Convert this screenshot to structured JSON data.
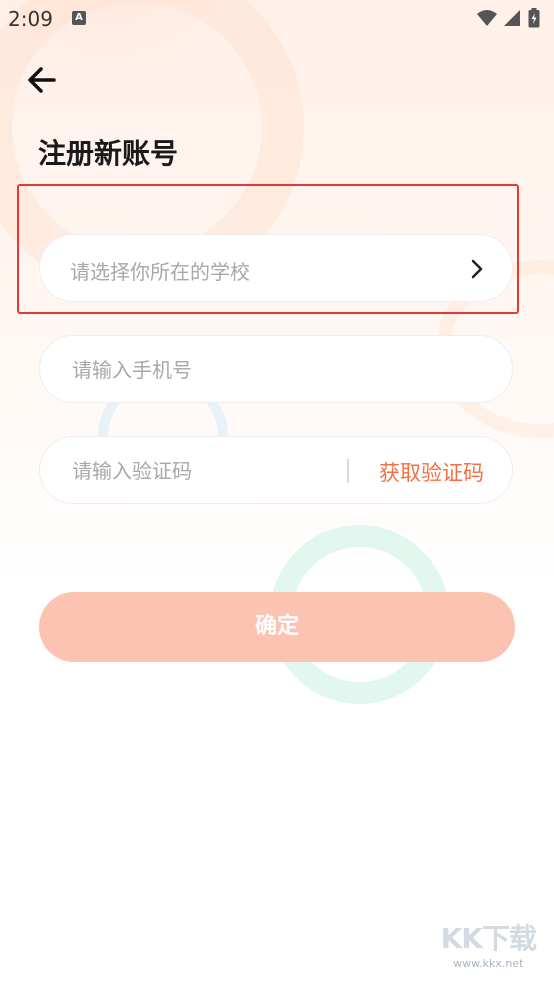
{
  "status_bar": {
    "time": "2:09",
    "notification_icon": "A"
  },
  "header": {
    "title": "注册新账号"
  },
  "form": {
    "school_placeholder": "请选择你所在的学校",
    "phone_placeholder": "请输入手机号",
    "code_placeholder": "请输入验证码",
    "get_code_label": "获取验证码",
    "confirm_label": "确定"
  },
  "watermark": {
    "logo_text": "KK下载",
    "url": "www.kkx.net"
  },
  "colors": {
    "accent": "#f07144",
    "button": "#fcc3b2",
    "highlight_box": "#e53935"
  },
  "icons": [
    "back-arrow-icon",
    "chevron-right-icon",
    "wifi-icon",
    "signal-icon",
    "battery-icon"
  ]
}
